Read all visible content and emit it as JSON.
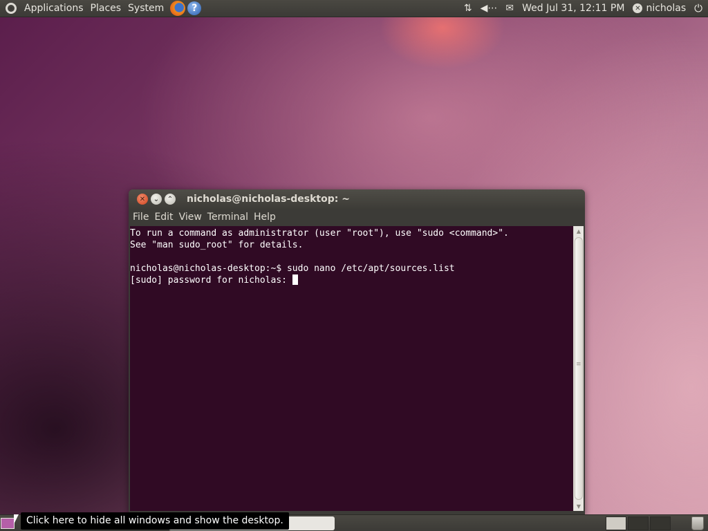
{
  "top_panel": {
    "menus": [
      "Applications",
      "Places",
      "System"
    ],
    "clock": "Wed Jul 31, 12:11 PM",
    "user": "nicholas",
    "icons": [
      "ubuntu-logo-icon",
      "firefox-icon",
      "help-icon",
      "network-icon",
      "volume-icon",
      "mail-icon",
      "user-status-icon",
      "power-icon"
    ]
  },
  "terminal": {
    "title": "nicholas@nicholas-desktop: ~",
    "menu": [
      "File",
      "Edit",
      "View",
      "Terminal",
      "Help"
    ],
    "lines": [
      "To run a command as administrator (user \"root\"), use \"sudo <command>\".",
      "See \"man sudo_root\" for details.",
      "",
      "nicholas@nicholas-desktop:~$ sudo nano /etc/apt/sources.list",
      "[sudo] password for nicholas: "
    ],
    "colors": {
      "background": "#300a24",
      "foreground": "#ffffff"
    }
  },
  "bottom_panel": {
    "tooltip": "Click here to hide all windows and show the desktop."
  }
}
